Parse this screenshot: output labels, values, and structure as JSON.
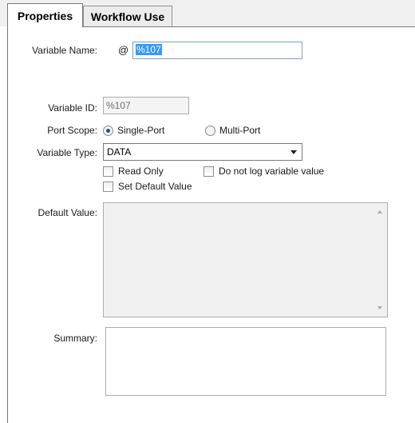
{
  "tabs": [
    {
      "label": "Properties",
      "active": true
    },
    {
      "label": "Workflow Use",
      "active": false
    }
  ],
  "form": {
    "variable_name": {
      "label": "Variable Name:",
      "prefix": "@",
      "value": "%107"
    },
    "variable_id": {
      "label": "Variable ID:",
      "value": "%107"
    },
    "port_scope": {
      "label": "Port Scope:",
      "options": [
        "Single-Port",
        "Multi-Port"
      ],
      "selected": "Single-Port"
    },
    "variable_type": {
      "label": "Variable Type:",
      "value": "DATA"
    },
    "checkboxes": {
      "read_only": {
        "label": "Read Only",
        "checked": false
      },
      "do_not_log": {
        "label": "Do not log variable value",
        "checked": false
      },
      "set_default": {
        "label": "Set Default Value",
        "checked": false
      }
    },
    "default_value": {
      "label": "Default Value:",
      "value": ""
    },
    "summary": {
      "label": "Summary:",
      "value": ""
    }
  },
  "colors": {
    "selection": "#3399ff",
    "focus_border": "#7aa0cc",
    "radio_dot": "#1e4f9c"
  }
}
